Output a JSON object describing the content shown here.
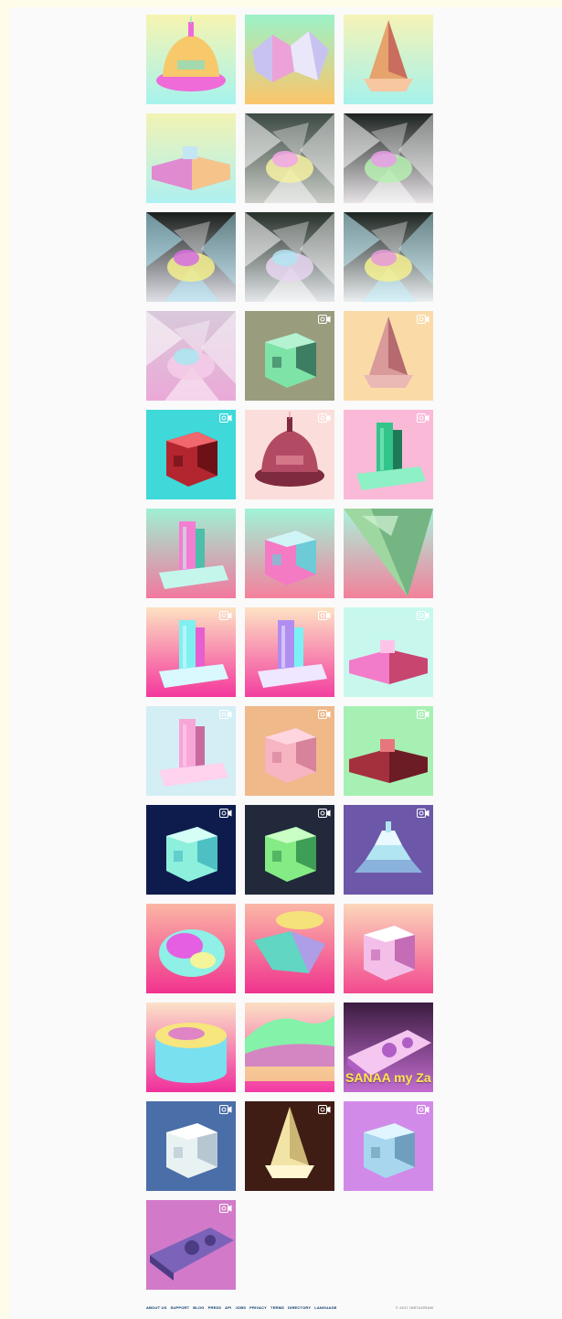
{
  "grid": {
    "posts": [
      {
        "bg": [
          "#f7f4b0",
          "#a6f3ee"
        ],
        "shape": "dome",
        "fill": [
          "#f7c96b",
          "#ee6bd8",
          "#7fe0c8"
        ],
        "video": false
      },
      {
        "bg": [
          "#9cf2c8",
          "#fbc56a"
        ],
        "shape": "crystal",
        "fill": [
          "#c8c2f0",
          "#f59ad1",
          "#ffffff"
        ],
        "video": false
      },
      {
        "bg": [
          "#f6f3b6",
          "#a5f2ec"
        ],
        "shape": "spire",
        "fill": [
          "#e7a36c",
          "#c96d5e",
          "#f6c7a0"
        ],
        "video": false
      },
      {
        "bg": [
          "#f2f3b3",
          "#aef0f1"
        ],
        "shape": "low",
        "fill": [
          "#e08ad1",
          "#f6c48a",
          "#c4e6f4"
        ],
        "video": false
      },
      {
        "bg": [
          "#3d4a44",
          "#c9ccc6"
        ],
        "shape": "chrome",
        "fill": [
          "#f5f1a2",
          "#f2a7e9",
          "#ffffff"
        ],
        "video": false
      },
      {
        "bg": [
          "#1d2321",
          "#e6e2e6"
        ],
        "shape": "chrome",
        "fill": [
          "#b6f0b1",
          "#e99de8",
          "#ffffff"
        ],
        "video": false
      },
      {
        "bg": [
          "#1a1e1c",
          "#dfdfe7"
        ],
        "shape": "chrome",
        "fill": [
          "#f3ee8d",
          "#d56fe0",
          "#b3f0ff"
        ],
        "video": false
      },
      {
        "bg": [
          "#263029",
          "#e4e7ea"
        ],
        "shape": "chrome",
        "fill": [
          "#e6d6f0",
          "#b3e4f2",
          "#ffffff"
        ],
        "video": false
      },
      {
        "bg": [
          "#1c2420",
          "#eaeef0"
        ],
        "shape": "chrome",
        "fill": [
          "#f4f190",
          "#e69ad9",
          "#c2f3ff"
        ],
        "video": false
      },
      {
        "bg": [
          "#d8c9da",
          "#eba9d8"
        ],
        "shape": "chrome",
        "fill": [
          "#f5cde8",
          "#a8e8ef",
          "#ffffff"
        ],
        "video": false
      },
      {
        "bg": [
          "#9a9c7e",
          "#9a9c7e"
        ],
        "shape": "block",
        "fill": [
          "#7ee3a6",
          "#3d7d63",
          "#b5f2d2"
        ],
        "video": true
      },
      {
        "bg": [
          "#fadba8",
          "#fadba8"
        ],
        "shape": "spire",
        "fill": [
          "#d99a99",
          "#b46a6f",
          "#eab8b5"
        ],
        "video": true
      },
      {
        "bg": [
          "#3ed9d8",
          "#3ed9d8"
        ],
        "shape": "block",
        "fill": [
          "#b3262f",
          "#6d1117",
          "#f0676e"
        ],
        "video": true
      },
      {
        "bg": [
          "#fbdedb",
          "#fbdedb"
        ],
        "shape": "dome",
        "fill": [
          "#b34a64",
          "#7e2a3f",
          "#e38a99"
        ],
        "video": true
      },
      {
        "bg": [
          "#fbb9d8",
          "#fbb9d8"
        ],
        "shape": "tower",
        "fill": [
          "#33c48b",
          "#1e7a57",
          "#8ef0c5"
        ],
        "video": true
      },
      {
        "bg": [
          "#9ff0d3",
          "#f2789e"
        ],
        "shape": "tower",
        "fill": [
          "#f37ed1",
          "#4bbfa9",
          "#c4f6ec"
        ],
        "video": false
      },
      {
        "bg": [
          "#9ff4d7",
          "#f5809d"
        ],
        "shape": "block",
        "fill": [
          "#f47ac4",
          "#6ccbd6",
          "#d0f5f7"
        ],
        "video": false
      },
      {
        "bg": [
          "#a9f2dc",
          "#f2819b"
        ],
        "shape": "inverted",
        "fill": [
          "#9ed7a0",
          "#5a9f70",
          "#d3f3d4"
        ],
        "video": false
      },
      {
        "bg": [
          "#fde2c2",
          "#f4379c"
        ],
        "shape": "tower",
        "fill": [
          "#7ff0f0",
          "#e65ecf",
          "#d9f9ff"
        ],
        "video": true
      },
      {
        "bg": [
          "#fde3c4",
          "#f33f9f"
        ],
        "shape": "tower",
        "fill": [
          "#b08df0",
          "#7af2f5",
          "#efe6ff"
        ],
        "video": true
      },
      {
        "bg": [
          "#c8f8ed",
          "#c8f8ed"
        ],
        "shape": "low",
        "fill": [
          "#f27cc9",
          "#c7456f",
          "#ffc3e8"
        ],
        "video": true
      },
      {
        "bg": [
          "#d3eef5",
          "#d3eef5"
        ],
        "shape": "tower",
        "fill": [
          "#f7a6d8",
          "#c86a9f",
          "#ffd2ee"
        ],
        "video": true
      },
      {
        "bg": [
          "#efb98a",
          "#efb98a"
        ],
        "shape": "block",
        "fill": [
          "#f7b4c1",
          "#d7839b",
          "#ffd6df"
        ],
        "video": true
      },
      {
        "bg": [
          "#a7f0b3",
          "#a7f0b3"
        ],
        "shape": "low",
        "fill": [
          "#a5303d",
          "#6c1c25",
          "#e7777f"
        ],
        "video": true
      },
      {
        "bg": [
          "#0e1c4d",
          "#0e1c4d"
        ],
        "shape": "block",
        "fill": [
          "#8df0dc",
          "#4ec0c3",
          "#d5fff6"
        ],
        "video": true
      },
      {
        "bg": [
          "#21293b",
          "#21293b"
        ],
        "shape": "block",
        "fill": [
          "#85eb85",
          "#3e9e55",
          "#c9ffc4"
        ],
        "video": true
      },
      {
        "bg": [
          "#6c57a8",
          "#6c57a8"
        ],
        "shape": "ziggurat",
        "fill": [
          "#b1e5f2",
          "#8bb1dd",
          "#e9f9ff"
        ],
        "video": true
      },
      {
        "bg": [
          "#fbb6a4",
          "#f2338f"
        ],
        "shape": "blob",
        "fill": [
          "#8ef0e6",
          "#e45fe1",
          "#f4f59a"
        ],
        "video": false
      },
      {
        "bg": [
          "#fbb7a6",
          "#f0348e"
        ],
        "shape": "saucer",
        "fill": [
          "#60d6c3",
          "#c28ef0",
          "#f5e27a"
        ],
        "video": false
      },
      {
        "bg": [
          "#fcd7bb",
          "#f24a8e"
        ],
        "shape": "block",
        "fill": [
          "#f3bfe8",
          "#c46cb5",
          "#ffffff"
        ],
        "video": false
      },
      {
        "bg": [
          "#fbe2c8",
          "#f02f9c"
        ],
        "shape": "drum",
        "fill": [
          "#f7e57d",
          "#79e0f0",
          "#d86bd7"
        ],
        "video": false
      },
      {
        "bg": [
          "#fbe0c4",
          "#f23aa3"
        ],
        "shape": "wave",
        "fill": [
          "#84f2a8",
          "#e86ac8",
          "#f6f28c"
        ],
        "video": false
      },
      {
        "bg": [
          "#3b1c3f",
          "#c26dd0"
        ],
        "shape": "slab",
        "fill": [
          "#f4c6f0",
          "#b05ec5",
          "#ffffff"
        ],
        "video": false,
        "caption": "SANAA my Za"
      },
      {
        "bg": [
          "#4a6ea8",
          "#4a6ea8"
        ],
        "shape": "block",
        "fill": [
          "#e9f2f2",
          "#b7c7d2",
          "#ffffff"
        ],
        "video": true
      },
      {
        "bg": [
          "#3f1d14",
          "#3f1d14"
        ],
        "shape": "spire",
        "fill": [
          "#f2e4a6",
          "#cbb676",
          "#fff7d2"
        ],
        "video": true
      },
      {
        "bg": [
          "#d28ae9",
          "#d28ae9"
        ],
        "shape": "block",
        "fill": [
          "#a7d6ee",
          "#6f9fbe",
          "#e0f5ff"
        ],
        "video": true
      },
      {
        "bg": [
          "#d27ac9",
          "#d27ac9"
        ],
        "shape": "slab",
        "fill": [
          "#7a63b8",
          "#4c3c84",
          "#b5a3ea"
        ],
        "video": true
      }
    ]
  },
  "footer": {
    "links": [
      "ABOUT US",
      "SUPPORT",
      "BLOG",
      "PRESS",
      "API",
      "JOBS",
      "PRIVACY",
      "TERMS",
      "DIRECTORY",
      "LANGUAGE"
    ],
    "copyright": "© 2017 INSTAGRAM"
  }
}
